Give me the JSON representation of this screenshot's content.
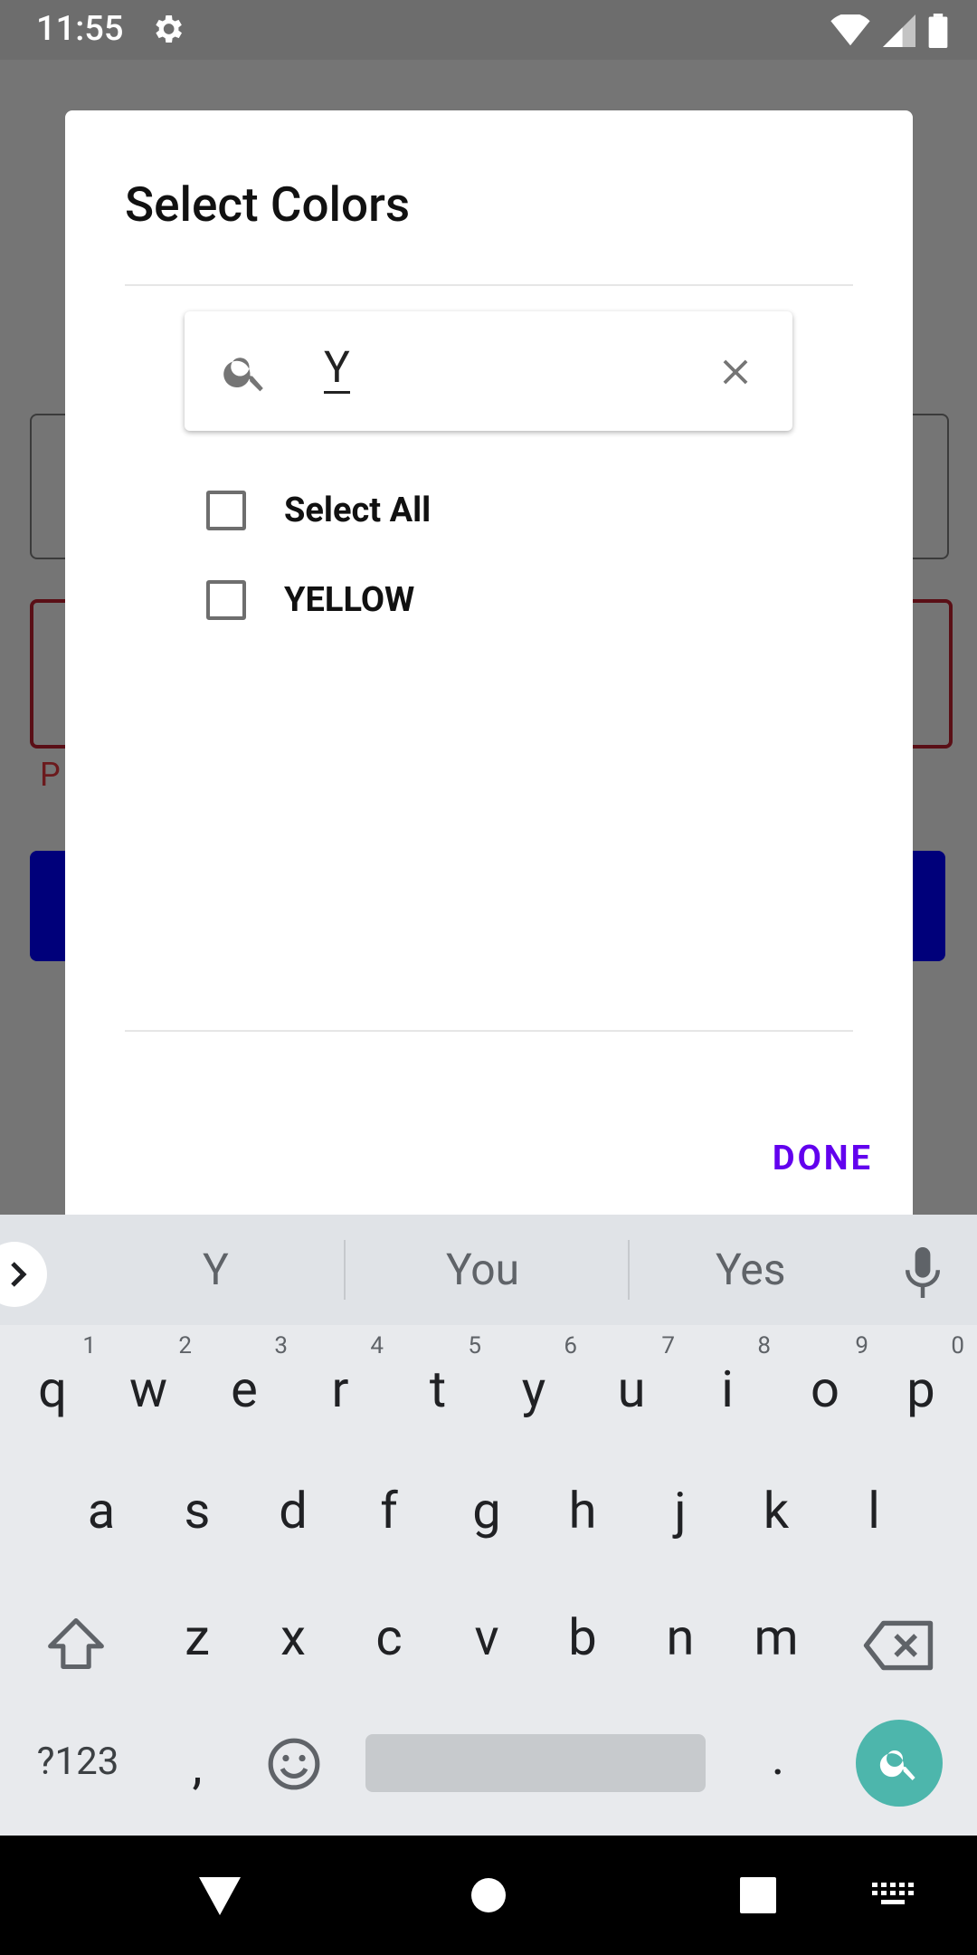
{
  "status_bar": {
    "time": "11:55"
  },
  "background": {
    "error_text": "P"
  },
  "dialog": {
    "title": "Select Colors",
    "search": {
      "query": "Y"
    },
    "options": [
      {
        "label": "Select All",
        "checked": false
      },
      {
        "label": "YELLOW",
        "checked": false
      }
    ],
    "done_label": "DONE"
  },
  "keyboard": {
    "suggestions": [
      "Y",
      "You",
      "Yes"
    ],
    "row1": [
      "q",
      "w",
      "e",
      "r",
      "t",
      "y",
      "u",
      "i",
      "o",
      "p"
    ],
    "row1_hints": [
      "1",
      "2",
      "3",
      "4",
      "5",
      "6",
      "7",
      "8",
      "9",
      "0"
    ],
    "row2": [
      "a",
      "s",
      "d",
      "f",
      "g",
      "h",
      "j",
      "k",
      "l"
    ],
    "row3": [
      "z",
      "x",
      "c",
      "v",
      "b",
      "n",
      "m"
    ],
    "symbols_label": "?123",
    "comma": ",",
    "period": "."
  },
  "colors": {
    "accent": "#6200ee",
    "fab": "#4db6ac"
  }
}
